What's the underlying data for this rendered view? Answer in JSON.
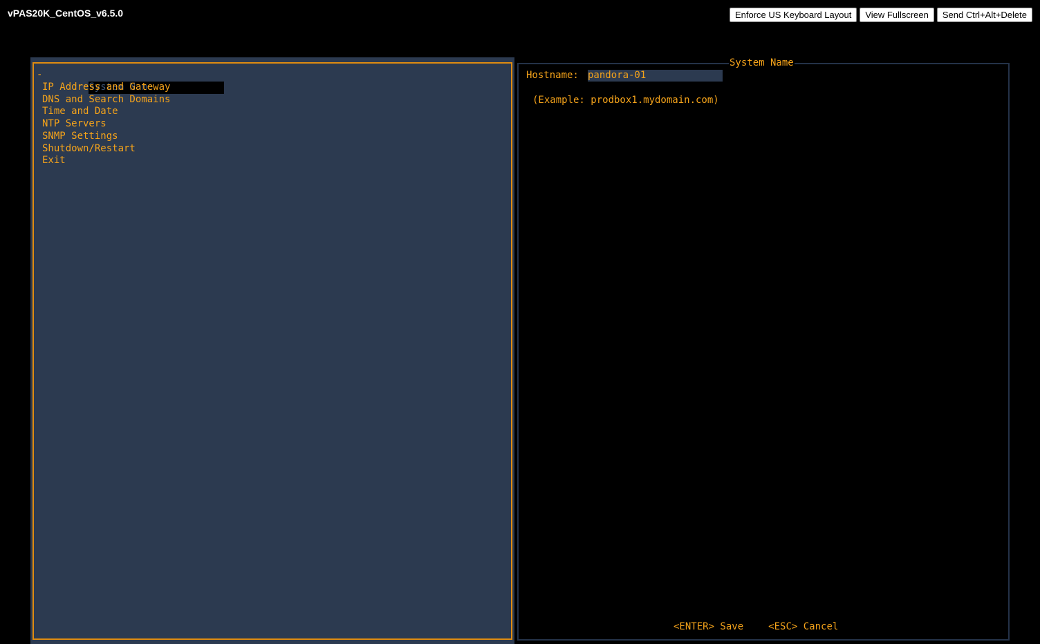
{
  "vm": {
    "title": "vPAS20K_CentOS_v6.5.0"
  },
  "toolbar": {
    "keyboard_label": "Enforce US Keyboard Layout",
    "fullscreen_label": "View Fullscreen",
    "cad_label": "Send Ctrl+Alt+Delete"
  },
  "menu": {
    "selection_marker": "-",
    "items": [
      {
        "label": "System Name"
      },
      {
        "label": "IP Address and Gateway"
      },
      {
        "label": "DNS and Search Domains"
      },
      {
        "label": "Time and Date"
      },
      {
        "label": "NTP Servers"
      },
      {
        "label": "SNMP Settings"
      },
      {
        "label": "Shutdown/Restart"
      },
      {
        "label": "Exit"
      }
    ]
  },
  "detail": {
    "title": "System Name",
    "hostname_label": "Hostname:",
    "hostname_value": "pandora-01",
    "example": "(Example: prodbox1.mydomain.com)",
    "save_label": "<ENTER> Save",
    "cancel_label": "<ESC> Cancel"
  },
  "colors": {
    "accent": "#f5a31a",
    "panel_bg": "#2c3a50",
    "background": "#000000"
  }
}
